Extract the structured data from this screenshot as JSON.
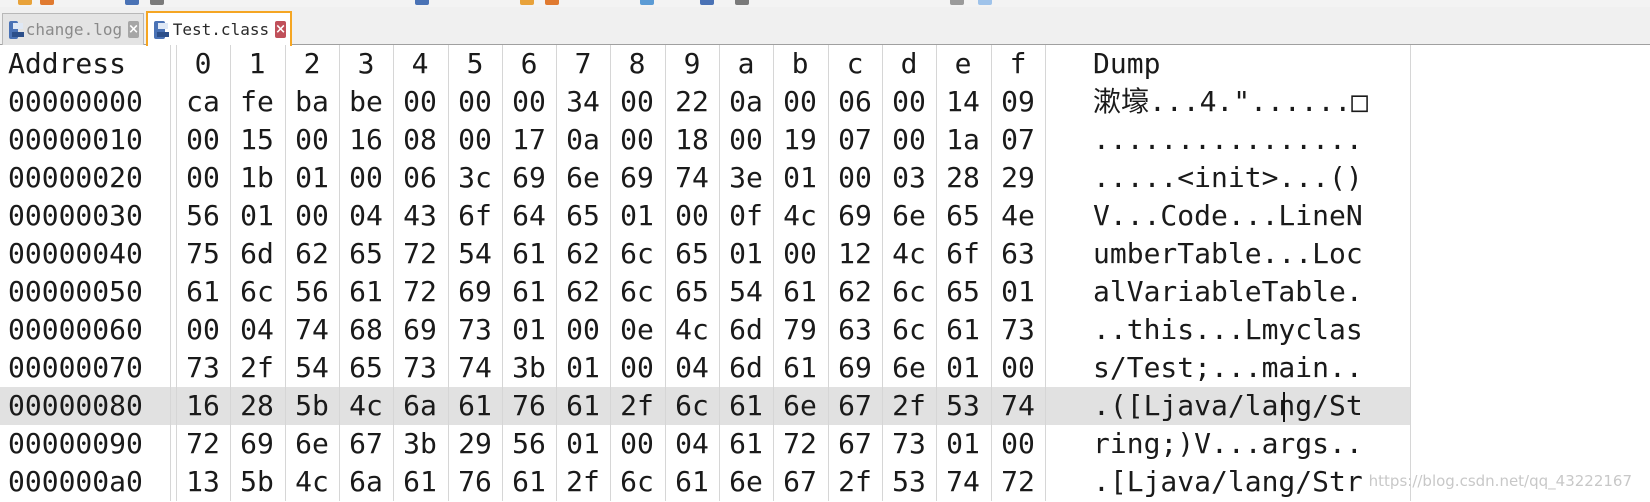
{
  "tabs": [
    {
      "label": "change.log",
      "active": false
    },
    {
      "label": "Test.class",
      "active": true
    }
  ],
  "header": {
    "address": "Address",
    "columns": [
      "0",
      "1",
      "2",
      "3",
      "4",
      "5",
      "6",
      "7",
      "8",
      "9",
      "a",
      "b",
      "c",
      "d",
      "e",
      "f"
    ],
    "dump": "Dump"
  },
  "rows": [
    {
      "address": "00000000",
      "bytes": [
        "ca",
        "fe",
        "ba",
        "be",
        "00",
        "00",
        "00",
        "34",
        "00",
        "22",
        "0a",
        "00",
        "06",
        "00",
        "14",
        "09"
      ],
      "dump": "漱壕...4.\"......□"
    },
    {
      "address": "00000010",
      "bytes": [
        "00",
        "15",
        "00",
        "16",
        "08",
        "00",
        "17",
        "0a",
        "00",
        "18",
        "00",
        "19",
        "07",
        "00",
        "1a",
        "07"
      ],
      "dump": "................"
    },
    {
      "address": "00000020",
      "bytes": [
        "00",
        "1b",
        "01",
        "00",
        "06",
        "3c",
        "69",
        "6e",
        "69",
        "74",
        "3e",
        "01",
        "00",
        "03",
        "28",
        "29"
      ],
      "dump": ".....<init>...()"
    },
    {
      "address": "00000030",
      "bytes": [
        "56",
        "01",
        "00",
        "04",
        "43",
        "6f",
        "64",
        "65",
        "01",
        "00",
        "0f",
        "4c",
        "69",
        "6e",
        "65",
        "4e"
      ],
      "dump": "V...Code...LineN"
    },
    {
      "address": "00000040",
      "bytes": [
        "75",
        "6d",
        "62",
        "65",
        "72",
        "54",
        "61",
        "62",
        "6c",
        "65",
        "01",
        "00",
        "12",
        "4c",
        "6f",
        "63"
      ],
      "dump": "umberTable...Loc"
    },
    {
      "address": "00000050",
      "bytes": [
        "61",
        "6c",
        "56",
        "61",
        "72",
        "69",
        "61",
        "62",
        "6c",
        "65",
        "54",
        "61",
        "62",
        "6c",
        "65",
        "01"
      ],
      "dump": "alVariableTable."
    },
    {
      "address": "00000060",
      "bytes": [
        "00",
        "04",
        "74",
        "68",
        "69",
        "73",
        "01",
        "00",
        "0e",
        "4c",
        "6d",
        "79",
        "63",
        "6c",
        "61",
        "73"
      ],
      "dump": "..this...Lmyclas"
    },
    {
      "address": "00000070",
      "bytes": [
        "73",
        "2f",
        "54",
        "65",
        "73",
        "74",
        "3b",
        "01",
        "00",
        "04",
        "6d",
        "61",
        "69",
        "6e",
        "01",
        "00"
      ],
      "dump": "s/Test;...main.."
    },
    {
      "address": "00000080",
      "bytes": [
        "16",
        "28",
        "5b",
        "4c",
        "6a",
        "61",
        "76",
        "61",
        "2f",
        "6c",
        "61",
        "6e",
        "67",
        "2f",
        "53",
        "74"
      ],
      "dump": ".([Ljava/lang/St",
      "selected": true
    },
    {
      "address": "00000090",
      "bytes": [
        "72",
        "69",
        "6e",
        "67",
        "3b",
        "29",
        "56",
        "01",
        "00",
        "04",
        "61",
        "72",
        "67",
        "73",
        "01",
        "00"
      ],
      "dump": "ring;)V...args.."
    },
    {
      "address": "000000a0",
      "bytes": [
        "13",
        "5b",
        "4c",
        "6a",
        "61",
        "76",
        "61",
        "2f",
        "6c",
        "61",
        "6e",
        "67",
        "2f",
        "53",
        "74",
        "72"
      ],
      "dump": ".[Ljava/lang/Str"
    }
  ],
  "watermark": "https://blog.csdn.net/qq_43222167",
  "colors": {
    "active_tab_border": "#f5a623",
    "selected_row": "#e1e1e1",
    "close_active": "#c0505a"
  }
}
